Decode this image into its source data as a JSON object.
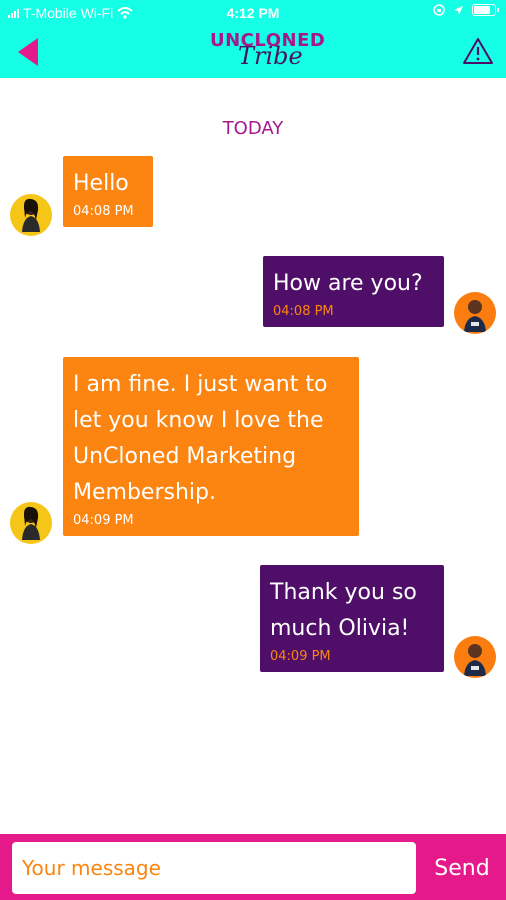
{
  "status_bar": {
    "carrier": "T-Mobile Wi-Fi",
    "time": "4:12 PM",
    "battery_level": 0.85
  },
  "header": {
    "back_icon": "back-arrow-icon",
    "logo_top": "UNCLONED",
    "logo_bottom": "Tribe",
    "alert_icon": "warning-icon"
  },
  "conversation": {
    "day_label": "TODAY",
    "messages": [
      {
        "side": "left",
        "text": "Hello",
        "time": "04:08 PM",
        "avatar": "olivia-avatar"
      },
      {
        "side": "right",
        "text": "How are you?",
        "time": "04:08 PM",
        "avatar": "man-avatar"
      },
      {
        "side": "left",
        "text": "I am fine. I just want to\nlet you know I love the\nUnCloned Marketing\nMembership.",
        "time": "04:09 PM",
        "avatar": "olivia-avatar"
      },
      {
        "side": "right",
        "text": "Thank you so\nmuch Olivia!",
        "time": "04:09 PM",
        "avatar": "man-avatar"
      }
    ]
  },
  "composer": {
    "placeholder": "Your message",
    "value": "",
    "send_label": "Send"
  },
  "colors": {
    "header_bg": "#14ffe6",
    "accent_magenta": "#e6198a",
    "incoming_bubble": "#fb8510",
    "outgoing_bubble": "#4f0f68",
    "day_label": "#a6198c"
  }
}
